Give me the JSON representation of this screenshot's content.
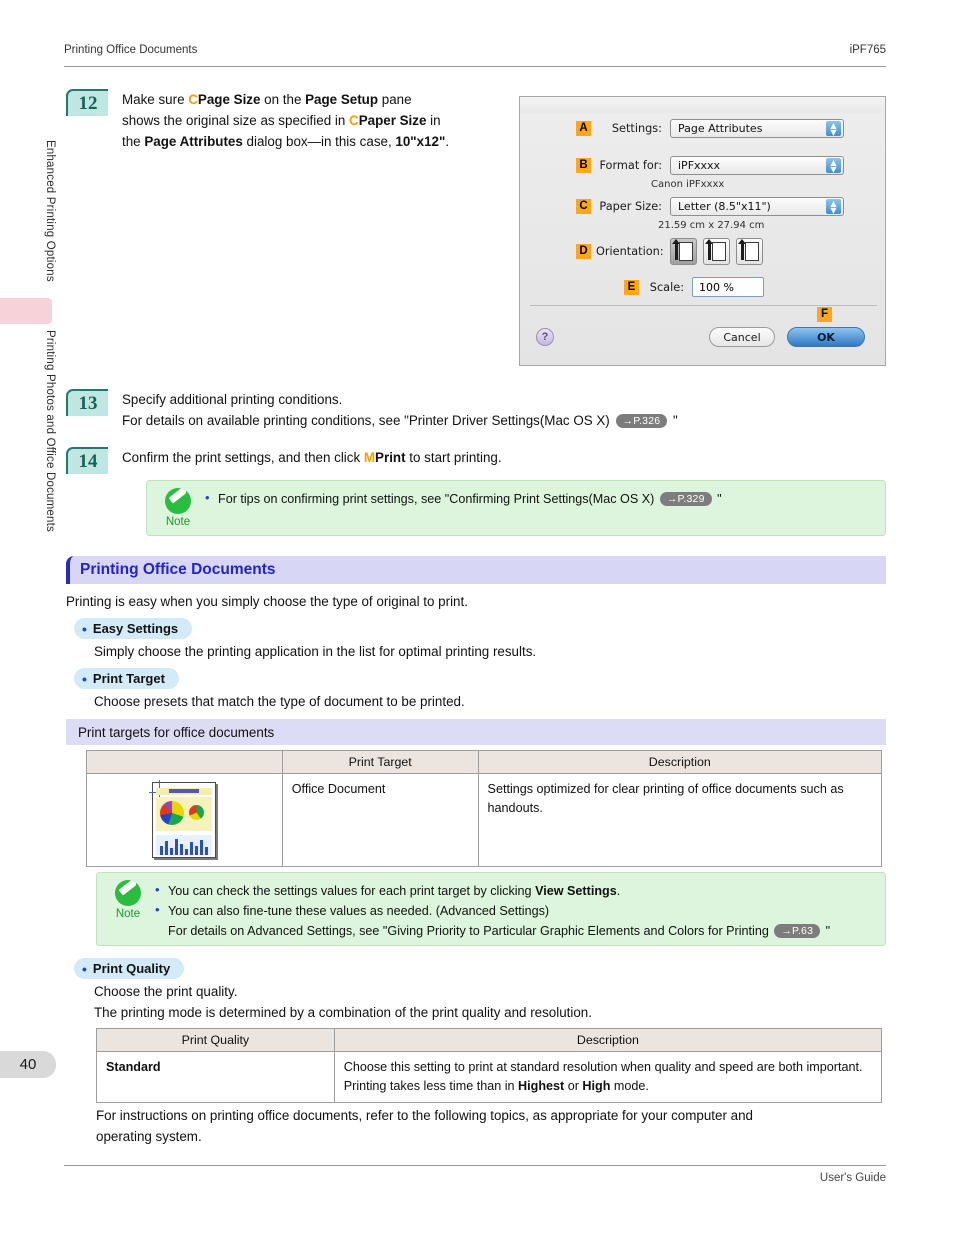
{
  "header": {
    "left": "Printing Office Documents",
    "right": "iPF765"
  },
  "footer": {
    "right": "User's Guide"
  },
  "sidebar": {
    "tab_top": "Enhanced Printing Options",
    "tab_bottom": "Printing Photos and Office Documents",
    "page_number": "40"
  },
  "steps": {
    "s12": {
      "number": "12",
      "line1_a": "Make sure ",
      "line1_tag": "C",
      "line1_b": "Page Size",
      "line1_c": " on the ",
      "line1_d": "Page Setup",
      "line1_e": " pane",
      "line2_a": "shows the original size as specified in ",
      "line2_tag": "C",
      "line2_b": "Paper Size",
      "line2_c": " in",
      "line3_a": "the ",
      "line3_b": "Page Attributes",
      "line3_c": " dialog box—in this case, ",
      "line3_d": "10\"x12\"",
      "line3_e": "."
    },
    "s13": {
      "number": "13",
      "line1": "Specify additional printing conditions.",
      "line2_a": "For details on available printing conditions, see \"Printer Driver Settings(Mac OS X) ",
      "ref": "→P.326",
      "line2_b": " \""
    },
    "s14": {
      "number": "14",
      "line1_a": "Confirm the print settings, and then click ",
      "tag": "M",
      "line1_b": "Print",
      "line1_c": " to start printing."
    }
  },
  "dialog": {
    "settings": {
      "badge": "A",
      "label": "Settings:",
      "value": "Page Attributes"
    },
    "format_for": {
      "badge": "B",
      "label": "Format for:",
      "value": "iPFxxxx",
      "sub": "Canon iPFxxxx"
    },
    "paper_size": {
      "badge": "C",
      "label": "Paper Size:",
      "value": "Letter (8.5\"x11\")",
      "sub": "21.59 cm x 27.94 cm"
    },
    "orientation": {
      "badge": "D",
      "label": "Orientation:"
    },
    "scale": {
      "badge": "E",
      "label": "Scale:",
      "value": "100 %"
    },
    "help": "?",
    "cancel": "Cancel",
    "ok": "OK",
    "ok_badge": "F"
  },
  "note1": {
    "label": "Note",
    "item_a": "For tips on confirming print settings, see \"Confirming Print Settings(Mac OS X) ",
    "ref": "→P.329",
    "item_b": " \""
  },
  "section": {
    "title": "Printing Office Documents",
    "intro": "Printing is easy when you simply choose the type of original to print.",
    "bullets": [
      {
        "title": "Easy Settings",
        "desc": "Simply choose the printing application in the list for optimal printing results."
      },
      {
        "title": "Print Target",
        "desc": "Choose presets that match the type of document to be printed."
      }
    ]
  },
  "print_targets": {
    "heading": "Print targets for office documents",
    "columns": [
      "",
      "Print Target",
      "Description"
    ],
    "rows": [
      {
        "thumb": "office-document-thumbnail",
        "target": "Office Document",
        "description": "Settings optimized for clear printing of office documents such as handouts."
      }
    ]
  },
  "note2": {
    "label": "Note",
    "item1_a": "You can check the settings values for each print target by clicking ",
    "item1_b": "View Settings",
    "item1_c": ".",
    "item2": "You can also fine-tune these values as needed. (Advanced Settings)",
    "item2_cont_a": "For details on Advanced Settings, see \"Giving Priority to Particular Graphic Elements and Colors for Printing ",
    "item2_ref": "→P.63",
    "item2_cont_b": " \""
  },
  "print_quality": {
    "pill": "Print Quality",
    "line1": "Choose the print quality.",
    "line2": "The printing mode is determined by a combination of the print quality and resolution.",
    "columns": [
      "Print Quality",
      "Description"
    ],
    "rows": [
      {
        "quality": "Standard",
        "desc_line1": "Choose this setting to print at standard resolution when quality and speed are both important.",
        "desc_line2_a": "Printing takes less time than in ",
        "desc_line2_b": "Highest",
        "desc_line2_c": " or ",
        "desc_line2_d": "High",
        "desc_line2_e": " mode."
      }
    ]
  },
  "closing": {
    "line1": "For instructions on printing office documents, refer to the following topics, as appropriate for your computer and",
    "line2": "operating system."
  },
  "colors": {
    "step_badge_bg": "#bfe6e0",
    "step_badge_border": "#1f7a72",
    "tag_orange": "#f5a000",
    "section_header_bg": "#d7d7f5",
    "section_header_text": "#2323cc",
    "note_bg": "#ddf5dd",
    "note_green": "#2bbd3f",
    "pill_bg": "#d3eaf9",
    "table_header_bg": "#ece4df",
    "page_ref_bg": "#7d7d7d"
  }
}
